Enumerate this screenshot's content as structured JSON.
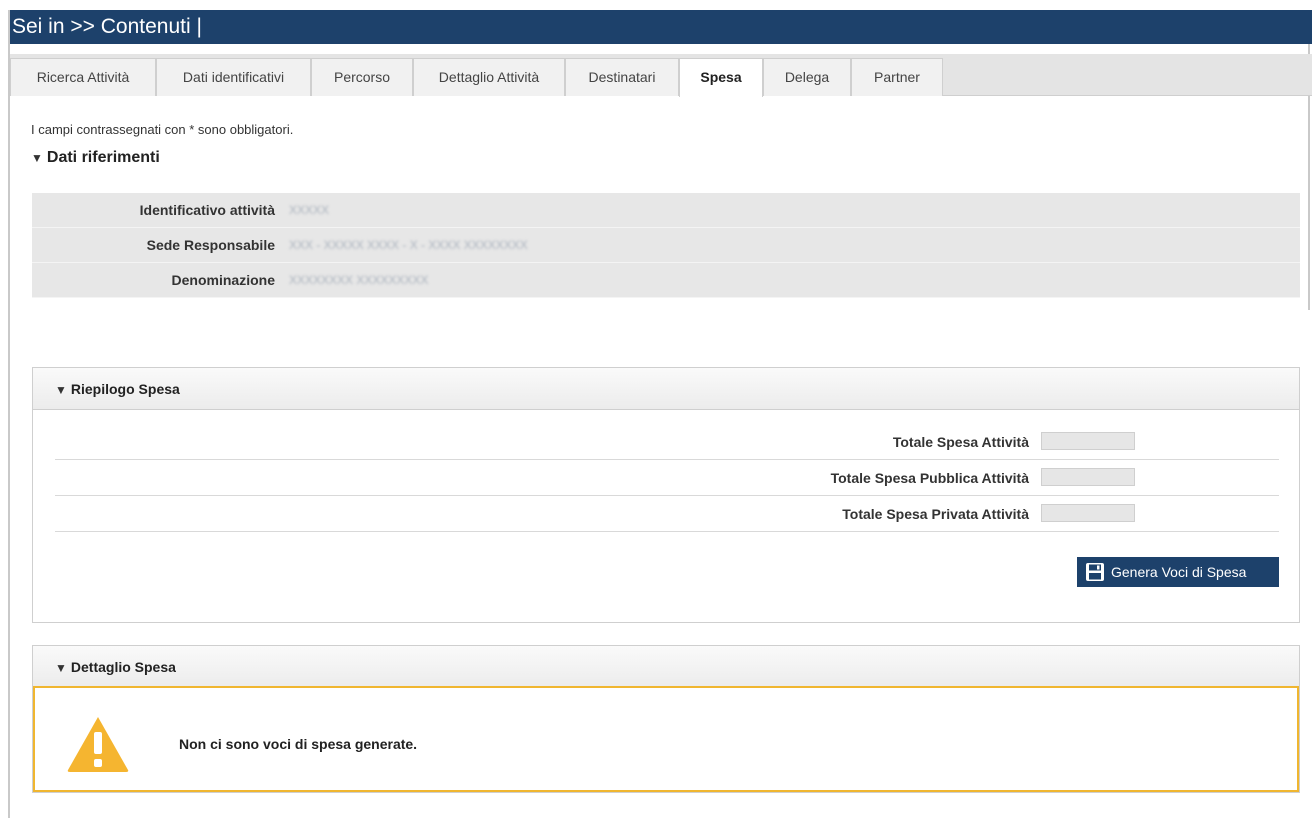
{
  "header": {
    "title": "Sei in >> Contenuti |"
  },
  "tabs": [
    {
      "label": "Ricerca Attività",
      "active": false
    },
    {
      "label": "Dati identificativi",
      "active": false
    },
    {
      "label": "Percorso",
      "active": false
    },
    {
      "label": "Dettaglio Attività",
      "active": false
    },
    {
      "label": "Destinatari",
      "active": false
    },
    {
      "label": "Spesa",
      "active": true
    },
    {
      "label": "Delega",
      "active": false
    },
    {
      "label": "Partner",
      "active": false
    }
  ],
  "form": {
    "required_note": "I campi contrassegnati con * sono obbligatori.",
    "section_title": "Dati riferimenti",
    "fields": [
      {
        "label": "Identificativo attività",
        "value": "XXXXX"
      },
      {
        "label": "Sede Responsabile",
        "value": "XXX - XXXXX XXXX - X - XXXX XXXXXXXX"
      },
      {
        "label": "Denominazione",
        "value": "XXXXXXXX XXXXXXXXX"
      }
    ]
  },
  "riepilogo": {
    "title": "Riepilogo Spesa",
    "rows": [
      {
        "label": "Totale Spesa Attività",
        "value": ""
      },
      {
        "label": "Totale Spesa Pubblica Attività",
        "value": ""
      },
      {
        "label": "Totale Spesa Privata Attività",
        "value": ""
      }
    ],
    "button_label": "Genera Voci di Spesa"
  },
  "dettaglio": {
    "title": "Dettaglio Spesa",
    "message": "Non ci sono voci di spesa generate."
  },
  "colors": {
    "header": "#1d416b",
    "warning_border": "#f0b630",
    "warning_icon": "#f5b530"
  },
  "icons": {
    "collapse": "triangle-down-icon",
    "save": "floppy-disk-icon",
    "warning": "warning-triangle-icon"
  }
}
